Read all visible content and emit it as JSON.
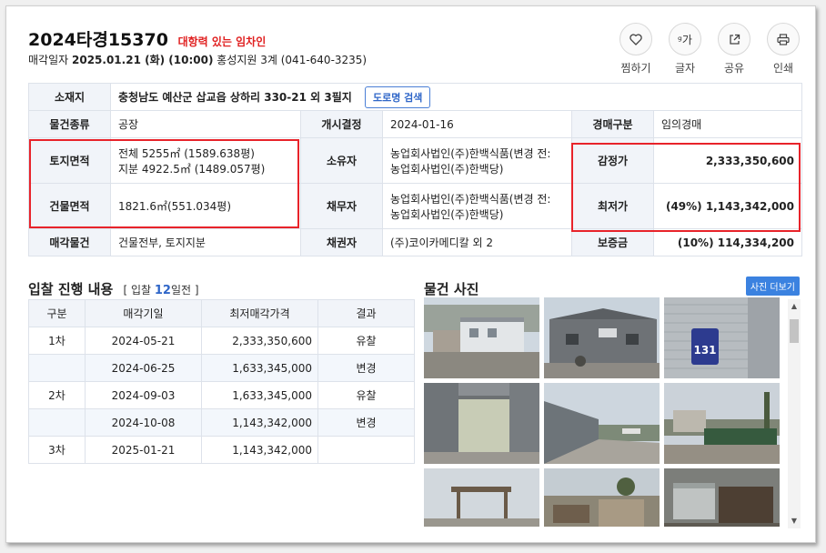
{
  "header": {
    "case_no": "2024타경15370",
    "tag": "대항력 있는 임차인",
    "sale_label": "매각일자",
    "sale_date": "2025.01.21 (화) (10:00)",
    "court": "홍성지원 3계 (041-640-3235)"
  },
  "actions": [
    {
      "label": "찜하기",
      "icon": "heart-icon"
    },
    {
      "label": "글자",
      "icon": "font-size-icon",
      "glyph": "ᵍ가"
    },
    {
      "label": "공유",
      "icon": "share-icon"
    },
    {
      "label": "인쇄",
      "icon": "print-icon"
    }
  ],
  "info": {
    "address_label": "소재지",
    "address": "충청남도 예산군 삽교읍 상하리 330-21 외 3필지",
    "road_btn": "도로명 검색",
    "type_label": "물건종류",
    "type": "공장",
    "start_label": "개시결정",
    "start": "2024-01-16",
    "auction_type_label": "경매구분",
    "auction_type": "임의경매",
    "land_label": "토지면적",
    "land_line1": "전체 5255㎡ (1589.638평)",
    "land_line2": "지분 4922.5㎡ (1489.057평)",
    "owner_label": "소유자",
    "owner_line1": "농업회사법인(주)한백식품(변경 전:",
    "owner_line2": "농업회사법인(주)한백당)",
    "appraisal_label": "감정가",
    "appraisal": "2,333,350,600",
    "building_label": "건물면적",
    "building": "1821.6㎡(551.034평)",
    "debtor_label": "채무자",
    "debtor_line1": "농업회사법인(주)한백식품(변경 전:",
    "debtor_line2": "농업회사법인(주)한백당)",
    "minimum_label": "최저가",
    "minimum": "(49%) 1,143,342,000",
    "sale_item_label": "매각물건",
    "sale_item": "건물전부, 토지지분",
    "creditor_label": "채권자",
    "creditor": "(주)코이카메디칼 외 2",
    "deposit_label": "보증금",
    "deposit": "(10%) 114,334,200"
  },
  "bids": {
    "title": "입찰 진행 내용",
    "sub_prefix": "[ 입찰",
    "sub_days": "12",
    "sub_suffix": "일전 ]",
    "headers": [
      "구분",
      "매각기일",
      "최저매각가격",
      "결과"
    ],
    "rows": [
      {
        "round": "1차",
        "date": "2024-05-21",
        "price": "2,333,350,600",
        "result": "유찰"
      },
      {
        "round": "",
        "date": "2024-06-25",
        "price": "1,633,345,000",
        "result": "변경"
      },
      {
        "round": "2차",
        "date": "2024-09-03",
        "price": "1,633,345,000",
        "result": "유찰"
      },
      {
        "round": "",
        "date": "2024-10-08",
        "price": "1,143,342,000",
        "result": "변경"
      },
      {
        "round": "3차",
        "date": "2025-01-21",
        "price": "1,143,342,000",
        "result": ""
      }
    ]
  },
  "photos": {
    "title": "물건 사진",
    "more_btn": "사진 더보기",
    "sign_number": "131"
  }
}
